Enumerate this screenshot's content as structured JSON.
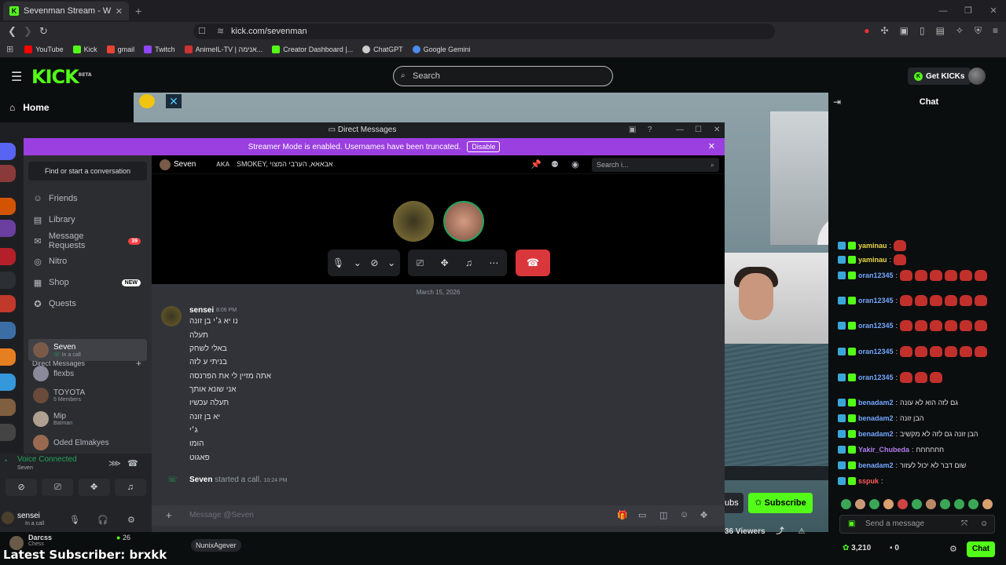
{
  "browser": {
    "tab_title": "Sevenman Stream - Watch Live o",
    "url": "kick.com/sevenman",
    "bookmarks": [
      "YouTube",
      "Kick",
      "gmail",
      "Twitch",
      "AnimeIL-TV | אנימה...",
      "Creator Dashboard |...",
      "ChatGPT",
      "Google Gemini"
    ]
  },
  "kick": {
    "logo": "KICK",
    "beta": "BETA",
    "search_placeholder": "Search",
    "get_kicks": "Get KICKs",
    "home": "Home",
    "subscribe": "Subscribe",
    "subs_fragment": "ubs",
    "viewers": "36 Viewers",
    "tag": "NunixAgever",
    "darcss_name": "Darcss",
    "darcss_game": "Chess",
    "darcss_count": "26",
    "latest_subscriber": "Latest Subscriber: brxkk"
  },
  "discord": {
    "window_title": "Direct Messages",
    "streamer_mode_text": "Streamer Mode is enabled. Usernames have been truncated.",
    "disable_label": "Disable",
    "find_conversation": "Find or start a conversation",
    "nav": [
      {
        "label": "Friends",
        "icon": "friends-icon"
      },
      {
        "label": "Library",
        "icon": "library-icon"
      },
      {
        "label": "Message Requests",
        "icon": "mail-icon",
        "badge": "39"
      },
      {
        "label": "Nitro",
        "icon": "nitro-icon"
      },
      {
        "label": "Shop",
        "icon": "shop-icon",
        "new": "NEW"
      },
      {
        "label": "Quests",
        "icon": "quests-icon"
      }
    ],
    "dm_header": "Direct Messages",
    "dms": [
      {
        "name": "Seven",
        "sub": "In a call",
        "color": "#7a5a48"
      },
      {
        "name": "flexbs",
        "sub": "",
        "color": "#8a8a9a"
      },
      {
        "name": "TOYOTA",
        "sub": "5 Members",
        "color": "#6a4a3a"
      },
      {
        "name": "Mip",
        "sub": "Batman",
        "color": "#b0a090"
      },
      {
        "name": "Oded Elmakyes",
        "sub": "",
        "color": "#9a6a50"
      }
    ],
    "voice_connected": "Voice Connected",
    "voice_channel": "Seven",
    "user_name": "sensei",
    "user_status": "In a call",
    "chat_user": "Seven",
    "aka_label": "AKA",
    "aka_value": "SMOKEY, אבאאא, הערבי המצוי",
    "search_placeholder": "Search i...",
    "date": "March 15, 2026",
    "author": "sensei",
    "time": "8:06 PM",
    "messages": [
      "נו יא ג׳י בן זונה",
      "תעלה",
      "באלי לשחק",
      "בניתי ע לזה",
      "אתה מזיין לי את הפרנסה",
      "אני שונא אותך",
      "תעלה עכשיו",
      "יא בן זונה",
      "ג׳י",
      "הומו",
      "פאגוט"
    ],
    "call_started_name": "Seven",
    "call_started_text": "started a call.",
    "call_started_time": "10:24 PM",
    "input_placeholder": "Message @Seven"
  },
  "chat": {
    "title": "Chat",
    "messages": [
      {
        "user": "yaminau",
        "color": "#e8d84a",
        "text": "",
        "emotes": 1
      },
      {
        "user": "yaminau",
        "color": "#e8d84a",
        "text": "",
        "emotes": 1
      },
      {
        "user": "oran12345",
        "color": "#73a7ff",
        "text": "",
        "emotes": 6
      },
      {
        "user": "oran12345",
        "color": "#73a7ff",
        "text": "",
        "emotes": 6
      },
      {
        "user": "oran12345",
        "color": "#73a7ff",
        "text": "",
        "emotes": 6
      },
      {
        "user": "oran12345",
        "color": "#73a7ff",
        "text": "",
        "emotes": 6
      },
      {
        "user": "oran12345",
        "color": "#73a7ff",
        "text": "",
        "emotes": 3
      },
      {
        "user": "benadam2",
        "color": "#73a7ff",
        "text": "גם לזה הוא לא עונה",
        "emotes": 0
      },
      {
        "user": "benadam2",
        "color": "#73a7ff",
        "text": "הבן זונה",
        "emotes": 0
      },
      {
        "user": "benadam2",
        "color": "#73a7ff",
        "text": "הבן זונה גם לזה לא מקשיב",
        "emotes": 0
      },
      {
        "user": "Yakir_Chubeda",
        "color": "#b17ef0",
        "text": "חחחחחח",
        "emotes": 0
      },
      {
        "user": "benadam2",
        "color": "#73a7ff",
        "text": "שום דבר לא יכול לעזור",
        "emotes": 0
      },
      {
        "user": "sspuk",
        "color": "#ff5b5b",
        "text": "",
        "emotes": 0
      }
    ],
    "send_placeholder": "Send a message",
    "kicks_count": "3,210",
    "zero": "0",
    "chat_button": "Chat"
  },
  "colors": {
    "kick_green": "#53fc18",
    "discord_purple": "#9b3fe1",
    "end_call_red": "#da373c"
  }
}
